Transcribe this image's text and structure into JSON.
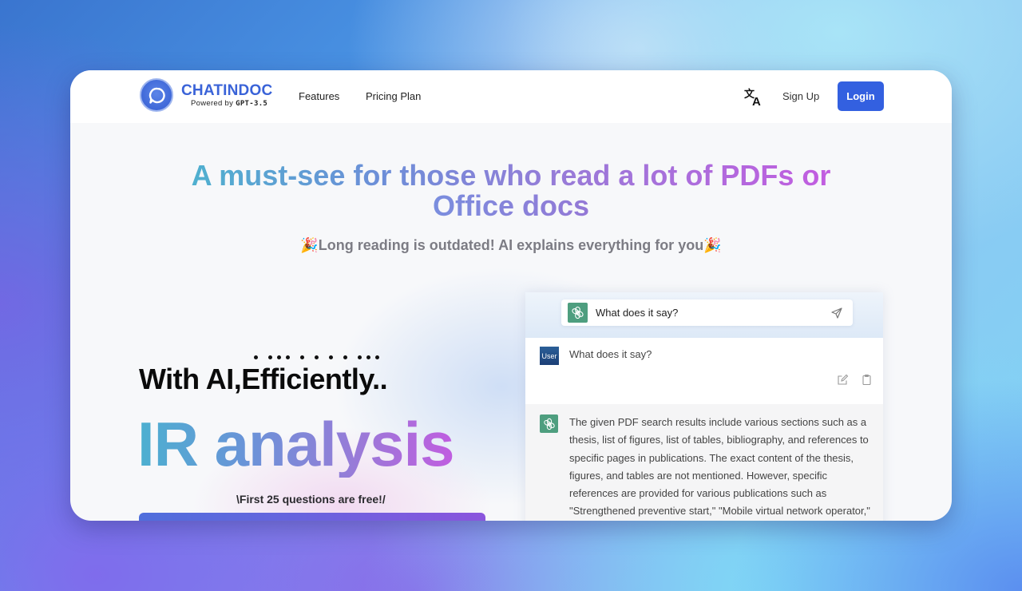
{
  "header": {
    "brand": "CHATINDOC",
    "powered_prefix": "Powered by ",
    "powered_model": "GPT-3.5",
    "nav": [
      {
        "label": "Features"
      },
      {
        "label": "Pricing Plan"
      }
    ],
    "language_icon": "translate-icon",
    "signup_label": "Sign Up",
    "login_label": "Login"
  },
  "hero": {
    "headline_line1": "A must-see for those who read a lot of PDFs or",
    "headline_line2": "Office docs",
    "subline": "🎉Long reading is outdated! AI explains everything for you🎉",
    "with_ai": "With AI,Efficiently..",
    "rotating_word": "IR analysis",
    "free_note": "\\First 25 questions are free!/",
    "cta_label": ""
  },
  "chat": {
    "input_value": "What does it say?",
    "user_badge": "User",
    "user_message": "What does it say?",
    "ai_message": "The given PDF search results include various sections such as a thesis, list of figures, list of tables, bibliography, and references to specific pages in publications. The exact content of the thesis, figures, and tables are not mentioned. However, specific references are provided for various publications such as \"Strengthened preventive start,\" \"Mobile virtual network operator,\" and \"QOE of"
  },
  "colors": {
    "brand": "#3a63d8",
    "login_button": "#3360e0",
    "gpt_green": "#4e9e7f",
    "user_badge": "#1c3f76"
  }
}
